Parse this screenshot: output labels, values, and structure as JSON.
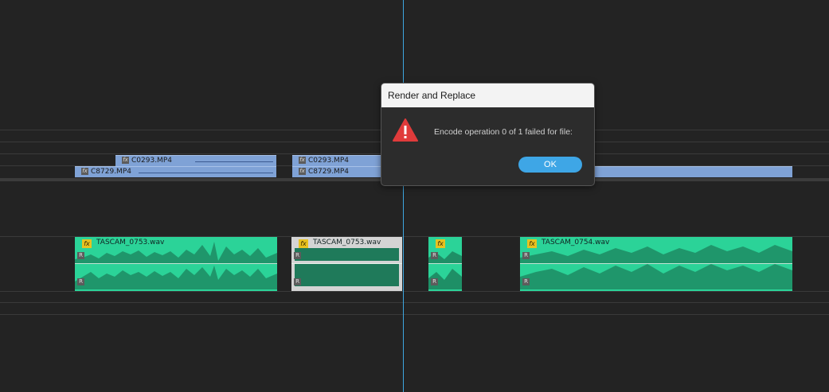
{
  "timeline": {
    "video_clips_v2": [
      {
        "id": "v2a",
        "name": "C0293.MP4",
        "fx": "fx"
      },
      {
        "id": "v2b",
        "name": "C0293.MP4",
        "fx": "fx"
      }
    ],
    "video_clips_v1": [
      {
        "id": "v1a",
        "name": "C8729.MP4",
        "fx": "fx"
      },
      {
        "id": "v1b",
        "name": "C8729.MP4",
        "fx": "fx"
      },
      {
        "id": "v1c",
        "name": "",
        "fx": ""
      }
    ],
    "audio_clips": [
      {
        "id": "a1",
        "name": "TASCAM_0753.wav",
        "fx": "fx",
        "channel_tag": "R",
        "selected": false
      },
      {
        "id": "a2",
        "name": "TASCAM_0753.wav",
        "fx": "fx",
        "channel_tag": "R",
        "selected": true
      },
      {
        "id": "a3",
        "name": "",
        "fx": "fx",
        "channel_tag": "R",
        "selected": false
      },
      {
        "id": "a4",
        "name": "TASCAM_0754.wav",
        "fx": "fx",
        "channel_tag": "R",
        "selected": false
      }
    ]
  },
  "dialog": {
    "title": "Render and Replace",
    "message": "Encode operation 0 of 1 failed for file:",
    "ok_label": "OK",
    "icon": "warning-triangle-icon"
  },
  "colors": {
    "background": "#232323",
    "video_clip": "#7fa2d6",
    "audio_clip": "#2bd398",
    "audio_selected": "#d4d4d4",
    "playhead": "#3da7e0",
    "ok_button": "#3ea6e6",
    "warning": "#e03b3b"
  }
}
